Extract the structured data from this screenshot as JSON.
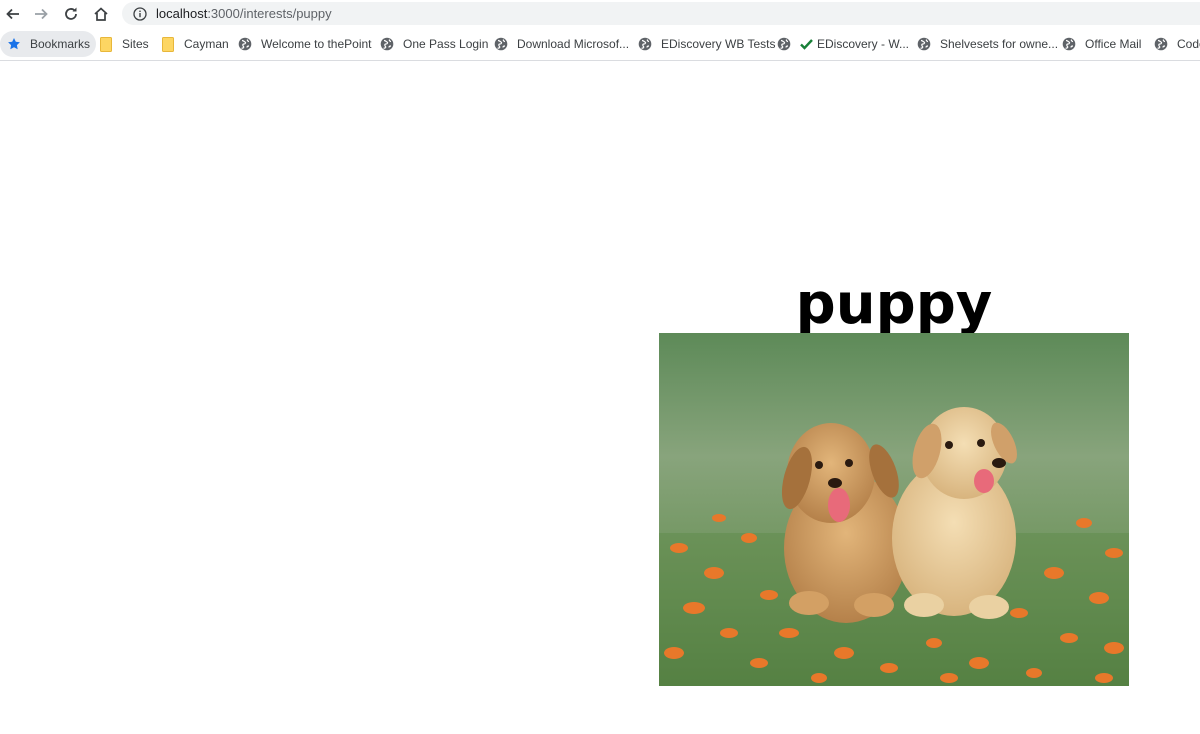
{
  "toolbar": {
    "url_host": "localhost",
    "url_path": ":3000/interests/puppy"
  },
  "bookmarks": [
    {
      "label": "Bookmarks",
      "icon": "star-icon"
    },
    {
      "label": "Sites",
      "icon": "folder-icon"
    },
    {
      "label": "Cayman",
      "icon": "folder-icon"
    },
    {
      "label": "Welcome to thePoint",
      "icon": "globe-icon"
    },
    {
      "label": "One Pass Login",
      "icon": "globe-icon"
    },
    {
      "label": "Download Microsof...",
      "icon": "globe-icon"
    },
    {
      "label": "EDiscovery WB Tests",
      "icon": "globe-icon"
    },
    {
      "label": "EDiscovery - W...",
      "icon": "globe-icon"
    },
    {
      "label": "Shelvesets for owne...",
      "icon": "globe-icon"
    },
    {
      "label": "Office Mail",
      "icon": "globe-icon"
    },
    {
      "label": "Code",
      "icon": "globe-icon"
    }
  ],
  "page": {
    "heading": "puppy"
  },
  "colors": {
    "omnibox_bg": "#f1f3f4",
    "folder_yellow": "#fdd663",
    "star_blue": "#1a73e8",
    "check_green": "#188038"
  }
}
